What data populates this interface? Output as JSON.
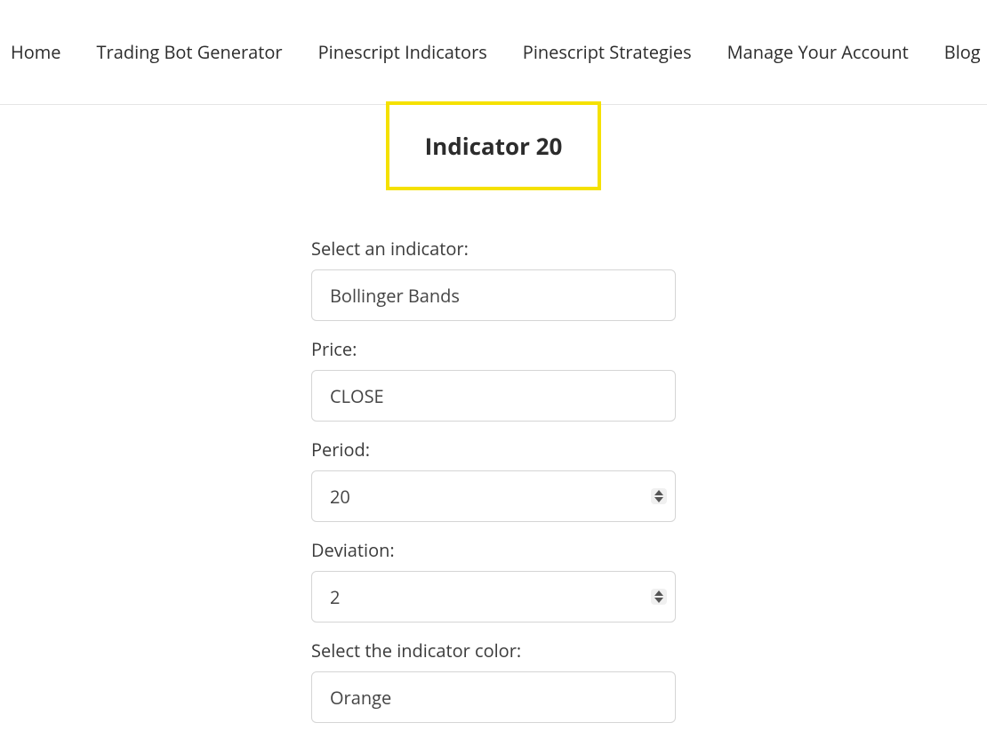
{
  "nav": {
    "items": [
      {
        "label": "Home"
      },
      {
        "label": "Trading Bot Generator"
      },
      {
        "label": "Pinescript Indicators"
      },
      {
        "label": "Pinescript Strategies"
      },
      {
        "label": "Manage Your Account"
      },
      {
        "label": "Blog"
      }
    ]
  },
  "header": {
    "title": "Indicator 20"
  },
  "form": {
    "indicator": {
      "label": "Select an indicator:",
      "value": "Bollinger Bands"
    },
    "price": {
      "label": "Price:",
      "value": "CLOSE"
    },
    "period": {
      "label": "Period:",
      "value": "20"
    },
    "deviation": {
      "label": "Deviation:",
      "value": "2"
    },
    "color": {
      "label": "Select the indicator color:",
      "value": "Orange"
    }
  }
}
